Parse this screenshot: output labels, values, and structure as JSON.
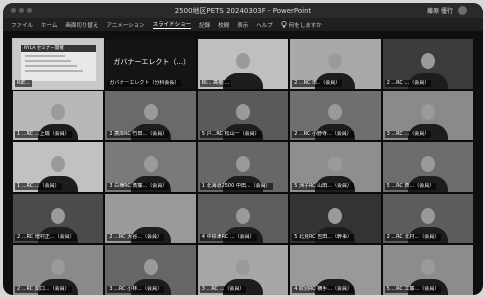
{
  "window": {
    "title": "2500地区PETS 20240303F - PowerPoint",
    "user": "藤原 優行"
  },
  "ribbon": {
    "tabs": [
      {
        "label": "ファイル"
      },
      {
        "label": "ホーム"
      },
      {
        "label": "画面切り替え"
      },
      {
        "label": "アニメーション"
      },
      {
        "label": "スライドショー",
        "active": true
      },
      {
        "label": "記録"
      },
      {
        "label": "校閲"
      },
      {
        "label": "表示"
      },
      {
        "label": "ヘルプ"
      }
    ],
    "search_label": "何をしますか"
  },
  "shared_screen": {
    "slide_header": "RYLA セミナー開催",
    "presenter_title": "ガバナーエレクト（...）"
  },
  "participants": [
    {
      "name": "RIE...",
      "bg": "#c9c9c9",
      "special": "slide"
    },
    {
      "name": "ガバナーエレクト（分科会長）",
      "bg": "#141414",
      "special": "title"
    },
    {
      "name": "RI... 髙橋 ...",
      "bg": "#bfbfbf"
    },
    {
      "name": "2 ...RC 市..（会員）",
      "bg": "#a9a9a9"
    },
    {
      "name": "2 ...RC ...（会員）",
      "bg": "#3c3c3c"
    },
    {
      "name": "1 ...RC ...上瑞（会員）",
      "bg": "#b8b8b8"
    },
    {
      "name": "2 廣岸RC 竹田...（会員）",
      "bg": "#6a6a6a"
    },
    {
      "name": "5 戸...RC 松山一（会員）",
      "bg": "#5a5a5a"
    },
    {
      "name": "2 ...RC 小野寺...（会員）",
      "bg": "#6f6f6f"
    },
    {
      "name": "3 ...RC ...（会員）",
      "bg": "#8a8a8a"
    },
    {
      "name": "1 ...RC ...（会員）",
      "bg": "#c1c1c1"
    },
    {
      "name": "3 白樺RC 斎藤...（会員）",
      "bg": "#7a7a7a"
    },
    {
      "name": "1 北海道2500 中田...（会員）",
      "bg": "#676767"
    },
    {
      "name": "5 洲子RC 山田...（会員）",
      "bg": "#8e8e8e"
    },
    {
      "name": "5 ...RC 斉...（会員）",
      "bg": "#6c6c6c"
    },
    {
      "name": "2 ...RC 増村正...（会員）",
      "bg": "#4b4b4b"
    },
    {
      "name": "2 ...RC 大谷...（会員）",
      "bg": "#9a9a9a"
    },
    {
      "name": "4 中標津RC ...（会員）",
      "bg": "#5e5e5e"
    },
    {
      "name": "5 北見RC 吉田...（幹事）",
      "bg": "#333333"
    },
    {
      "name": "2 ...RC 北村...（会員）",
      "bg": "#5c5c5c"
    },
    {
      "name": "2 ...RC 関口...（会員）",
      "bg": "#8a8a8a"
    },
    {
      "name": "3 ...RC 小林...（会員）",
      "bg": "#666666"
    },
    {
      "name": "3 ...RC ...（会員）",
      "bg": "#a6a6a6"
    },
    {
      "name": "4 紋別RC 横手...（会員）",
      "bg": "#999999"
    },
    {
      "name": "5 ...RC 工藤...（会員）",
      "bg": "#8c8c8c"
    }
  ]
}
